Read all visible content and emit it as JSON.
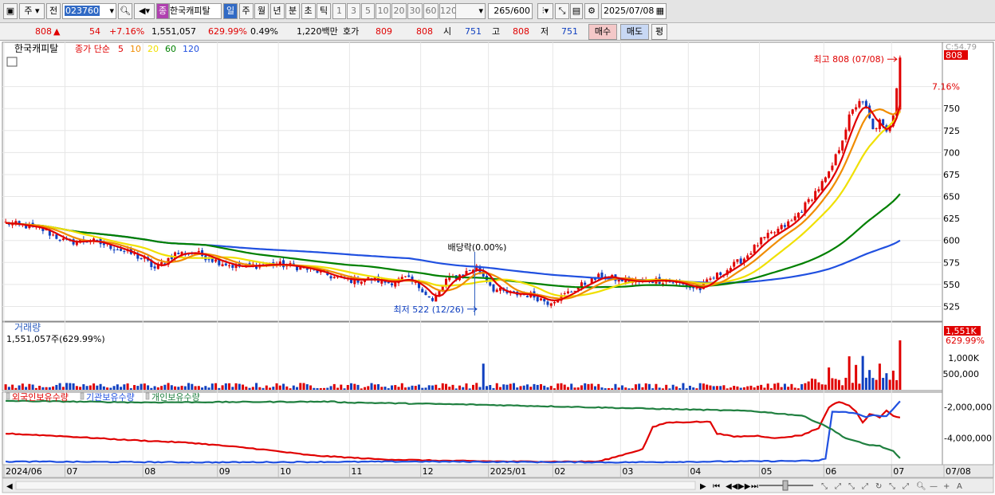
{
  "toolbar": {
    "period_selector": "주",
    "prev_label": "전",
    "stock_code": "023760",
    "stock_badge": "종",
    "stock_name": "한국캐피탈",
    "period_tabs": [
      "일",
      "주",
      "월",
      "년",
      "분",
      "초",
      "틱"
    ],
    "active_period": "일",
    "interval_buttons": [
      "1",
      "3",
      "5",
      "10",
      "20",
      "30",
      "60",
      "120"
    ],
    "count_value": "265",
    "count_total": "/600",
    "date_value": "2025/07/08"
  },
  "quote": {
    "price": "808",
    "change_arrow": "▲",
    "change": "54",
    "change_pct": "+7.16%",
    "volume": "1,551,057",
    "volume_ratio": "629.99%",
    "turnover_pct": "0.49%",
    "amount": "1,220백만",
    "quote_label": "호가",
    "ask": "809",
    "bid": "808",
    "open_label": "시",
    "open": "751",
    "high_label": "고",
    "high": "808",
    "low_label": "저",
    "low": "751",
    "buy_button": "매수",
    "sell_button": "매도",
    "eval_button": "평"
  },
  "colors": {
    "up": "#e00000",
    "down": "#1040c0",
    "ma5": "#e00000",
    "ma10": "#f08c00",
    "ma20": "#f0e000",
    "ma60": "#008000",
    "ma120": "#2050e0",
    "foreign": "#e00000",
    "institution": "#2050e0",
    "individual": "#208040"
  },
  "chart_data": [
    {
      "type": "candlestick",
      "title": "한국캐피탈",
      "legend": {
        "prefix": "종가 단순",
        "ma": [
          "5",
          "10",
          "20",
          "60",
          "120"
        ]
      },
      "ylim": [
        510,
        820
      ],
      "y_ticks": [
        525,
        550,
        575,
        600,
        625,
        650,
        675,
        700,
        725,
        750,
        775
      ],
      "y_tick_labels": [
        "525",
        "550",
        "575",
        "600",
        "625",
        "650",
        "675",
        "700",
        "725",
        "750",
        "7.16%"
      ],
      "x_labels": [
        {
          "label": "2024/06",
          "i": 0
        },
        {
          "label": "07",
          "i": 18
        },
        {
          "label": "08",
          "i": 41
        },
        {
          "label": "09",
          "i": 63
        },
        {
          "label": "10",
          "i": 81
        },
        {
          "label": "11",
          "i": 102
        },
        {
          "label": "12",
          "i": 123
        },
        {
          "label": "2025/01",
          "i": 143
        },
        {
          "label": "02",
          "i": 162
        },
        {
          "label": "03",
          "i": 182
        },
        {
          "label": "04",
          "i": 202
        },
        {
          "label": "05",
          "i": 223
        },
        {
          "label": "06",
          "i": 242
        },
        {
          "label": "07",
          "i": 262
        },
        {
          "label": "07/08",
          "i": 275
        }
      ],
      "n_bars": 265,
      "close_anchors": [
        [
          0,
          620
        ],
        [
          10,
          614
        ],
        [
          18,
          598
        ],
        [
          25,
          600
        ],
        [
          32,
          592
        ],
        [
          37,
          585
        ],
        [
          41,
          578
        ],
        [
          44,
          568
        ],
        [
          50,
          585
        ],
        [
          56,
          586
        ],
        [
          62,
          577
        ],
        [
          68,
          570
        ],
        [
          75,
          572
        ],
        [
          80,
          573
        ],
        [
          86,
          570
        ],
        [
          92,
          565
        ],
        [
          97,
          558
        ],
        [
          102,
          555
        ],
        [
          108,
          556
        ],
        [
          113,
          552
        ],
        [
          118,
          557
        ],
        [
          123,
          545
        ],
        [
          126,
          530
        ],
        [
          130,
          555
        ],
        [
          135,
          562
        ],
        [
          139,
          570
        ],
        [
          141,
          560
        ],
        [
          144,
          545
        ],
        [
          148,
          540
        ],
        [
          155,
          538
        ],
        [
          160,
          530
        ],
        [
          164,
          536
        ],
        [
          168,
          545
        ],
        [
          172,
          553
        ],
        [
          176,
          560
        ],
        [
          180,
          556
        ],
        [
          186,
          553
        ],
        [
          192,
          555
        ],
        [
          197,
          553
        ],
        [
          202,
          547
        ],
        [
          205,
          545
        ],
        [
          208,
          556
        ],
        [
          213,
          567
        ],
        [
          218,
          580
        ],
        [
          223,
          600
        ],
        [
          228,
          612
        ],
        [
          232,
          622
        ],
        [
          236,
          640
        ],
        [
          240,
          660
        ],
        [
          243,
          675
        ],
        [
          246,
          705
        ],
        [
          249,
          740
        ],
        [
          252,
          760
        ],
        [
          254,
          750
        ],
        [
          256,
          725
        ],
        [
          258,
          735
        ],
        [
          260,
          722
        ],
        [
          262,
          745
        ],
        [
          264,
          808
        ]
      ],
      "ma_end_values": {
        "ma120": 600,
        "ma60": 653,
        "ma20": 747,
        "ma10": 752,
        "ma5": 755
      },
      "current_label": "808",
      "annotations": [
        {
          "text": "최고 808 (07/08)",
          "at": 264,
          "value": 808
        },
        {
          "text": "최저 522 (12/26)",
          "at": 140,
          "value": 522
        },
        {
          "text": "배당락(0.00%)",
          "at": 138,
          "value": 578
        }
      ],
      "panel_label": "C:54.79"
    },
    {
      "type": "bar",
      "title": "거래량",
      "subtitle": "1,551,057주(629.99%)",
      "ylim": [
        0,
        1650000
      ],
      "y_ticks": [
        500000,
        1000000
      ],
      "y_tick_labels": [
        "500,000",
        "1,000K"
      ],
      "current_label": "1,551K",
      "current_ratio": "629.99%",
      "spikes": [
        [
          141,
          820000
        ],
        [
          243,
          700000
        ],
        [
          249,
          1050000
        ],
        [
          251,
          780000
        ],
        [
          253,
          1060000
        ],
        [
          255,
          620000
        ],
        [
          258,
          820000
        ],
        [
          260,
          520000
        ],
        [
          262,
          600000
        ],
        [
          264,
          1551057
        ]
      ]
    },
    {
      "type": "line",
      "series": [
        {
          "name": "외국인보유수량",
          "color_key": "foreign",
          "anchors": [
            [
              0,
              -3700000
            ],
            [
              15,
              -3850000
            ],
            [
              35,
              -4100000
            ],
            [
              55,
              -4300000
            ],
            [
              75,
              -4700000
            ],
            [
              90,
              -5100000
            ],
            [
              110,
              -5350000
            ],
            [
              130,
              -5450000
            ],
            [
              150,
              -5500000
            ],
            [
              175,
              -5500000
            ],
            [
              180,
              -5200000
            ],
            [
              188,
              -4700000
            ],
            [
              191,
              -3300000
            ],
            [
              195,
              -3000000
            ],
            [
              203,
              -2950000
            ],
            [
              208,
              -2950000
            ],
            [
              210,
              -3700000
            ],
            [
              215,
              -3900000
            ],
            [
              222,
              -3850000
            ],
            [
              228,
              -4000000
            ],
            [
              235,
              -3800000
            ],
            [
              240,
              -3350000
            ],
            [
              243,
              -2000000
            ],
            [
              246,
              -1650000
            ],
            [
              249,
              -1900000
            ],
            [
              251,
              -2300000
            ],
            [
              253,
              -3000000
            ],
            [
              255,
              -2450000
            ],
            [
              258,
              -2650000
            ],
            [
              260,
              -2200000
            ],
            [
              262,
              -2550000
            ],
            [
              264,
              -2700000
            ]
          ]
        },
        {
          "name": "기관보유수량",
          "color_key": "institution",
          "anchors": [
            [
              0,
              -5500000
            ],
            [
              60,
              -5550000
            ],
            [
              120,
              -5500000
            ],
            [
              180,
              -5550000
            ],
            [
              240,
              -5450000
            ],
            [
              242,
              -5300000
            ],
            [
              244,
              -2300000
            ],
            [
              250,
              -2350000
            ],
            [
              254,
              -2650000
            ],
            [
              256,
              -2500000
            ],
            [
              260,
              -2600000
            ],
            [
              264,
              -1650000
            ]
          ]
        },
        {
          "name": "개인보유수량",
          "color_key": "individual",
          "anchors": [
            [
              0,
              -1600000
            ],
            [
              40,
              -1700000
            ],
            [
              96,
              -1650000
            ],
            [
              100,
              -1700000
            ],
            [
              140,
              -1850000
            ],
            [
              180,
              -2050000
            ],
            [
              220,
              -2250000
            ],
            [
              235,
              -2550000
            ],
            [
              242,
              -3200000
            ],
            [
              248,
              -4000000
            ],
            [
              254,
              -4400000
            ],
            [
              258,
              -4500000
            ],
            [
              262,
              -4850000
            ],
            [
              264,
              -5300000
            ]
          ]
        }
      ],
      "ylim": [
        -5600000,
        -1300000
      ],
      "y_ticks": [
        -2000000,
        -4000000
      ],
      "y_tick_labels": [
        "-2,000,000",
        "-4,000,000"
      ]
    }
  ]
}
